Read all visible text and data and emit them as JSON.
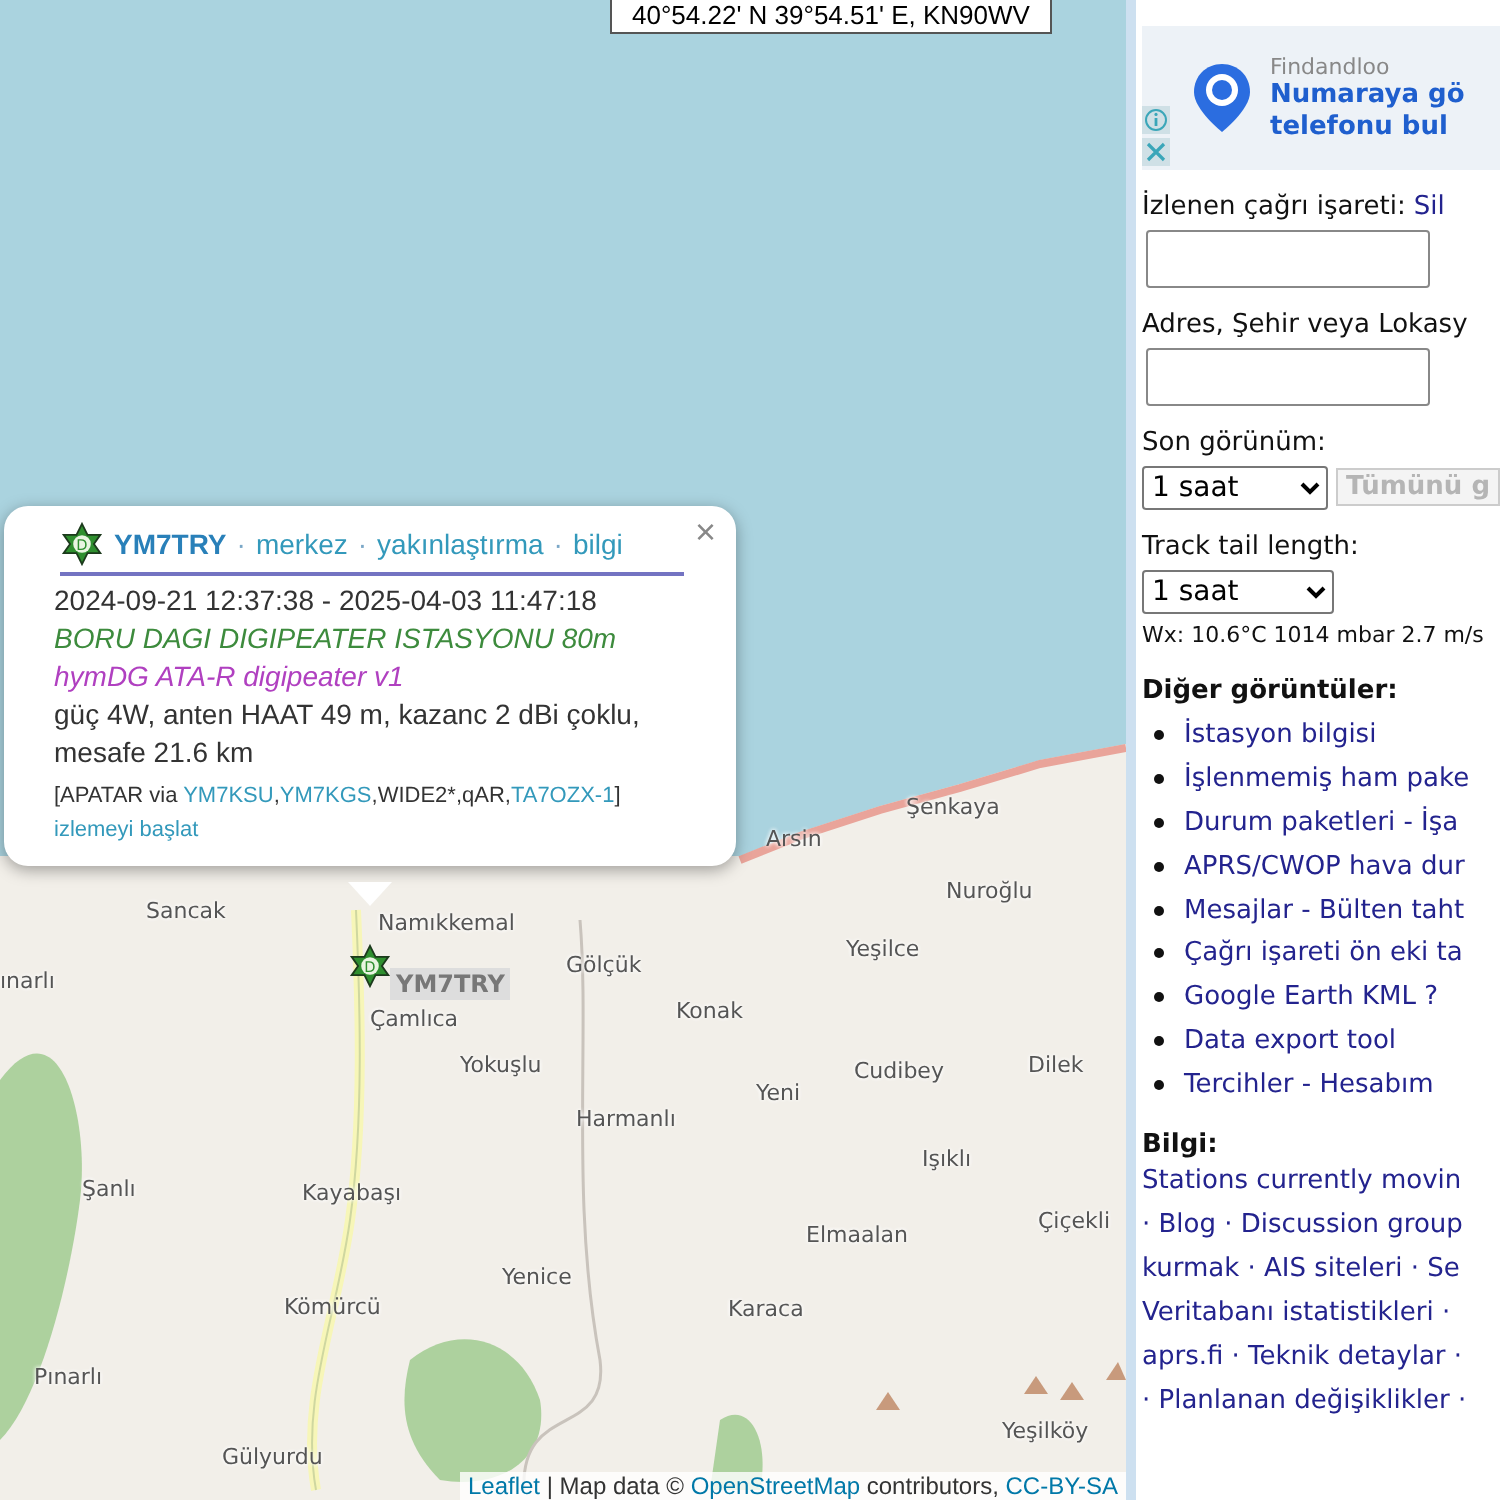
{
  "map": {
    "coordinates": "40°54.22' N 39°54.51' E, KN90WV",
    "places": [
      "Şenkaya",
      "Arsin",
      "Nuroğlu",
      "Sancak",
      "Namıkkemal",
      "Gölçük",
      "Yeşilce",
      "ınarlı",
      "Konak",
      "Çamlıca",
      "Yokuşlu",
      "Cudibey",
      "Dilek",
      "Yeni",
      "Harmanlı",
      "Işıklı",
      "Şanlı",
      "Kayabaşı",
      "Çiçekli",
      "Elmaalan",
      "Yenice",
      "Kömürcü",
      "Karaca",
      "Pınarlı",
      "Yeşilköy",
      "Gülyurdu"
    ],
    "station_label": "YM7TRY",
    "symbol": "D",
    "attribution": [
      {
        "text": "Leaflet",
        "kind": "link"
      },
      {
        "text": " | Map data © ",
        "kind": "text"
      },
      {
        "text": "OpenStreetMap",
        "kind": "link"
      },
      {
        "text": " contributors, ",
        "kind": "text"
      },
      {
        "text": "CC-BY-SA",
        "kind": "link"
      }
    ]
  },
  "popup": {
    "callsign": "YM7TRY",
    "symbol": "D",
    "separator": "·",
    "links": [
      "merkez",
      "yakınlaştırma",
      "bilgi"
    ],
    "close": "×",
    "time_range": "2024-09-21 12:37:38 - 2025-04-03 11:47:18",
    "comment": "BORU DAGI DIGIPEATER ISTASYONU 80m",
    "device": "hymDG ATA-R digipeater v1",
    "details": "güç 4W, anten HAAT 49 m, kazanc 2 dBi çoklu, mesafe 21.6 km",
    "path": [
      {
        "text": "[APATAR via ",
        "kind": "text"
      },
      {
        "text": "YM7KSU",
        "kind": "link"
      },
      {
        "text": ",",
        "kind": "text"
      },
      {
        "text": "YM7KGS",
        "kind": "link"
      },
      {
        "text": ",WIDE2*,qAR,",
        "kind": "text"
      },
      {
        "text": "TA7OZX-1",
        "kind": "link"
      },
      {
        "text": "]",
        "kind": "text"
      }
    ],
    "track_link": "izlemeyi başlat"
  },
  "sidebar": {
    "ad": {
      "brand": "Findandloo",
      "headline": "Numaraya gö",
      "subline": "telefonu bul"
    },
    "tracked_label": "İzlenen çağrı işareti:",
    "clear_link": "Sil",
    "address_label": "Adres, Şehir veya Lokasy",
    "last_seen_label": "Son görünüm:",
    "last_seen_value": "1 saat",
    "show_all": {
      "label": "Tümünü g",
      "disabled": true
    },
    "tail_label": "Track tail length:",
    "tail_value": "1 saat",
    "weather": "Wx: 10.6°C 1014 mbar 2.7 m/s",
    "other_heading": "Diğer görüntüler:",
    "other_views": [
      {
        "links": [
          "İstasyon bilgisi"
        ]
      },
      {
        "links": [
          "İşlenmemiş ham pake"
        ]
      },
      {
        "links": [
          "Durum paketleri",
          "İşa"
        ]
      },
      {
        "links": [
          "APRS/CWOP hava dur"
        ]
      },
      {
        "links": [
          "Mesajlar",
          "Bülten taht"
        ]
      },
      {
        "links": [
          "Çağrı işareti ön eki ta"
        ]
      },
      {
        "links": [
          "Google Earth KML ?"
        ]
      },
      {
        "links": [
          "Data export tool"
        ]
      },
      {
        "links": [
          "Tercihler",
          "Hesabım"
        ]
      }
    ],
    "link_separator": "-",
    "info_heading": "Bilgi:",
    "info_lines": [
      "Stations currently movin",
      "· Blog · Discussion group",
      "kurmak · AIS siteleri · Se",
      "Veritabanı istatistikleri ·",
      "aprs.fi · Teknik detaylar ·",
      "· Planlanan değişiklikler ·"
    ]
  }
}
